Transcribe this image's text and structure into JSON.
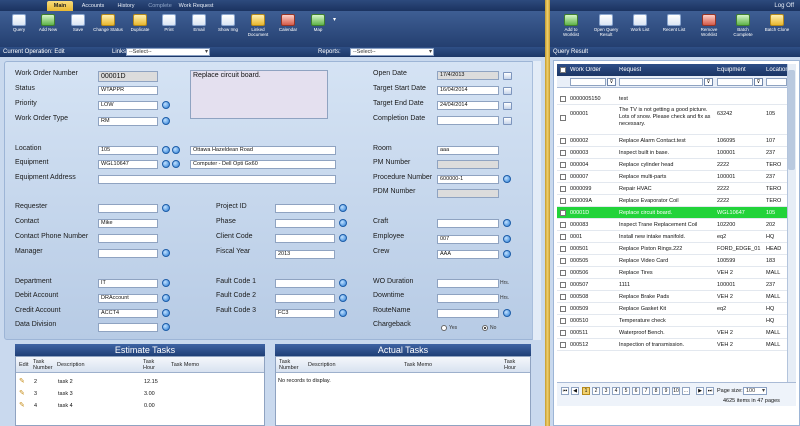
{
  "top_tabs": [
    {
      "label": "Main",
      "state": "active"
    },
    {
      "label": "Accounts",
      "state": "normal"
    },
    {
      "label": "History",
      "state": "normal"
    },
    {
      "label": "Complete",
      "state": "dim"
    },
    {
      "label": "Work Request",
      "state": "normal"
    }
  ],
  "log_off": "Log Off",
  "toolbar": [
    {
      "label": "Query",
      "icon": "query-icon"
    },
    {
      "label": "Add New",
      "icon": "add-new-icon"
    },
    {
      "label": "Save",
      "icon": "save-icon"
    },
    {
      "label": "Change Status",
      "icon": "change-status-icon"
    },
    {
      "label": "Duplicate",
      "icon": "duplicate-icon"
    },
    {
      "label": "Print",
      "icon": "print-icon"
    },
    {
      "label": "Email",
      "icon": "email-icon"
    },
    {
      "label": "Show Img",
      "icon": "show-image-icon"
    },
    {
      "label": "Linked Document",
      "icon": "linked-document-icon"
    },
    {
      "label": "Calendar",
      "icon": "calendar-icon"
    },
    {
      "label": "Map",
      "icon": "map-icon"
    }
  ],
  "right_toolbar": [
    {
      "label": "Add to Worklist",
      "icon": "add-worklist-icon"
    },
    {
      "label": "Open Query Result",
      "icon": "open-query-icon"
    },
    {
      "label": "Work List",
      "icon": "work-list-icon"
    },
    {
      "label": "Recent List",
      "icon": "recent-list-icon"
    },
    {
      "label": "Remove Worklist",
      "icon": "remove-worklist-icon"
    },
    {
      "label": "Batch Complete",
      "icon": "batch-complete-icon"
    },
    {
      "label": "Batch Clone",
      "icon": "batch-clone-icon"
    }
  ],
  "opbar": {
    "current_operation": "Current Operation: Edit",
    "links_label": "Links:",
    "links_value": "--Select--",
    "reports_label": "Reports:",
    "reports_value": "--Select--"
  },
  "query_result_title": "Query Result",
  "form": {
    "work_order_number_label": "Work Order Number",
    "work_order_number": "00001D",
    "description": "Replace circuit board.",
    "status_label": "Status",
    "status": "WTAPPR",
    "priority_label": "Priority",
    "priority": "LOW",
    "work_order_type_label": "Work Order Type",
    "work_order_type": "RM",
    "open_date_label": "Open Date",
    "open_date": "17/4/2013",
    "target_start_label": "Target Start Date",
    "target_start": "16/04/2014",
    "target_end_label": "Target End Date",
    "target_end": "24/04/2014",
    "completion_date_label": "Completion Date",
    "completion_date": "",
    "location_label": "Location",
    "location_code": "105",
    "location_desc": "Ottawa Hazeldean Road",
    "equipment_label": "Equipment",
    "equipment_code": "WGL10647",
    "equipment_desc": "Computer - Dell Opti Gx60",
    "equipment_address_label": "Equipment Address",
    "room_label": "Room",
    "room": "aaa",
    "pm_number_label": "PM Number",
    "procedure_number_label": "Procedure Number",
    "procedure_number": "600000-1",
    "pdm_number_label": "PDM Number",
    "requester_label": "Requester",
    "contact_label": "Contact",
    "contact": "Mike",
    "contact_phone_label": "Contact Phone Number",
    "manager_label": "Manager",
    "project_id_label": "Project ID",
    "phase_label": "Phase",
    "client_code_label": "Client Code",
    "fiscal_year_label": "Fiscal Year",
    "fiscal_year": "2013",
    "craft_label": "Craft",
    "employee_label": "Employee",
    "employee": "007",
    "crew_label": "Crew",
    "crew": "AAA",
    "department_label": "Department",
    "department": "IT",
    "debit_account_label": "Debit Account",
    "debit_account": "DRAccount",
    "credit_account_label": "Credit Account",
    "credit_account": "ACCT4",
    "data_division_label": "Data Division",
    "fault_code_1_label": "Fault Code 1",
    "fault_code_2_label": "Fault Code 2",
    "fault_code_3_label": "Fault Code 3",
    "fault_code_3": "FC3",
    "wo_duration_label": "WO Duration",
    "downtime_label": "Downtime",
    "routename_label": "RouteName",
    "hrs": "Hrs.",
    "chargeback_label": "Chargeback",
    "chargeback_yes": "Yes",
    "chargeback_no": "No",
    "chargeback_selected": "No"
  },
  "estimate_tasks": {
    "title": "Estimate Tasks",
    "headers": [
      "Edit",
      "Task Number",
      "Description",
      "Task Hour",
      "Task Memo"
    ],
    "rows": [
      {
        "num": "2",
        "desc": "task 2",
        "hour": "12.15"
      },
      {
        "num": "3",
        "desc": "task 3",
        "hour": "3.00"
      },
      {
        "num": "4",
        "desc": "task 4",
        "hour": "0.00"
      }
    ]
  },
  "actual_tasks": {
    "title": "Actual Tasks",
    "headers": [
      "Task Number",
      "Description",
      "Task Memo",
      "Task Hour"
    ],
    "empty": "No records to display."
  },
  "query_result": {
    "headers": [
      "Work Order",
      "Request",
      "Equipment",
      "Location"
    ],
    "rows": [
      {
        "wo": "0000005150",
        "req": "test",
        "eq": "",
        "loc": ""
      },
      {
        "wo": "000001",
        "req": "The TV is not getting a good picture. Lots of snow. Please check and fix as necessary.",
        "eq": "63242",
        "loc": "105"
      },
      {
        "wo": "000002",
        "req": "Replace Alarm Contact.test",
        "eq": "106095",
        "loc": "107"
      },
      {
        "wo": "000003",
        "req": "Inspect built in base.",
        "eq": "100001",
        "loc": "237"
      },
      {
        "wo": "000004",
        "req": "Replace cylinder head",
        "eq": "2222",
        "loc": "TERO"
      },
      {
        "wo": "000007",
        "req": "Replace multi-parts",
        "eq": "100001",
        "loc": "237"
      },
      {
        "wo": "0000099",
        "req": "Repair HVAC",
        "eq": "2222",
        "loc": "TERO"
      },
      {
        "wo": "000009A",
        "req": "Replace Evaporator Coil",
        "eq": "2222",
        "loc": "TERO"
      },
      {
        "wo": "00001D",
        "req": "Replace circuit board.",
        "eq": "WGL10647",
        "loc": "105",
        "highlight": true
      },
      {
        "wo": "000083",
        "req": "Inspect Trane Replacement Coil",
        "eq": "102200",
        "loc": "202"
      },
      {
        "wo": "0001",
        "req": "Install new intake manifold.",
        "eq": "eq2",
        "loc": "HQ"
      },
      {
        "wo": "000501",
        "req": "Replace Piston Rings.222",
        "eq": "FORD_EDGE_01",
        "loc": "HEAD"
      },
      {
        "wo": "000505",
        "req": "Replace Video Card",
        "eq": "100599",
        "loc": "183"
      },
      {
        "wo": "000506",
        "req": "Replace Tires",
        "eq": "VEH 2",
        "loc": "MALL"
      },
      {
        "wo": "000507",
        "req": "1111",
        "eq": "100001",
        "loc": "237"
      },
      {
        "wo": "000508",
        "req": "Replace Brake Pads",
        "eq": "VEH 2",
        "loc": "MALL"
      },
      {
        "wo": "000509",
        "req": "Replace Gasket Kit",
        "eq": "eq2",
        "loc": "HQ"
      },
      {
        "wo": "000510",
        "req": "Temperature check",
        "eq": "",
        "loc": "HQ"
      },
      {
        "wo": "000511",
        "req": "Waterproof Bench.",
        "eq": "VEH 2",
        "loc": "MALL"
      },
      {
        "wo": "000512",
        "req": "Inspection of transmission.",
        "eq": "VEH 2",
        "loc": "MALL"
      }
    ]
  },
  "pager": {
    "pages": [
      "1",
      "2",
      "3",
      "4",
      "5",
      "6",
      "7",
      "8",
      "9",
      "10",
      "..."
    ],
    "current": "1",
    "page_size_label": "Page size:",
    "page_size": "100",
    "summary": "4625 items in 47 pages"
  },
  "colors": {
    "highlight": "#22d33a",
    "accent": "#1f3f76",
    "gold": "#f1d170"
  }
}
